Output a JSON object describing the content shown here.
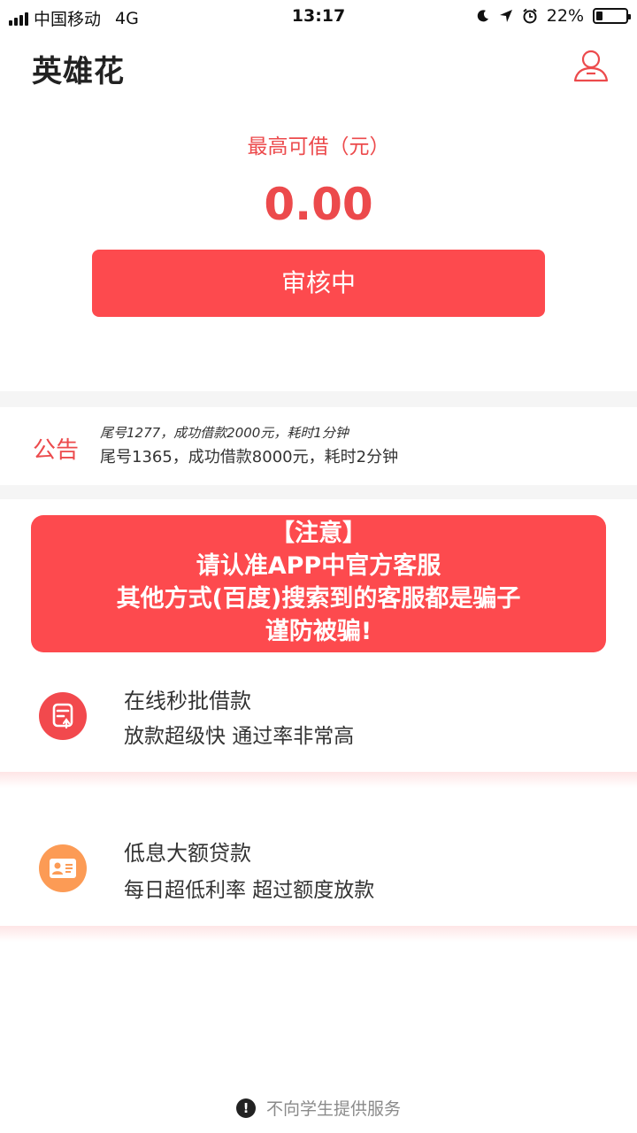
{
  "status_bar": {
    "carrier": "中国移动",
    "network": "4G",
    "time": "13:17",
    "battery": "22%",
    "battery_level": 0.22
  },
  "header": {
    "title": "英雄花",
    "user_icon": "user-icon"
  },
  "loan": {
    "limit_label": "最高可借（元）",
    "limit_amount": "0.00",
    "status_button": "审核中"
  },
  "notice": {
    "label": "公告",
    "items": [
      "尾号1277，成功借款2000元，耗时1分钟",
      "尾号1365，成功借款8000元，耗时2分钟"
    ]
  },
  "warning": {
    "lines": [
      "【注意】",
      "请认准APP中官方客服",
      "其他方式(百度)搜索到的客服都是骗子",
      "谨防被骗!"
    ]
  },
  "features": [
    {
      "icon": "document-icon",
      "icon_color": "#f2494d",
      "title": "在线秒批借款",
      "desc": "放款超级快 通过率非常高"
    },
    {
      "icon": "id-card-icon",
      "icon_color": "#fc9b55",
      "title": "低息大额贷款",
      "desc": "每日超低利率 超过额度放款"
    }
  ],
  "footer": {
    "icon": "alert-icon",
    "text": "不向学生提供服务"
  },
  "colors": {
    "accent": "#fd4a4e",
    "accent_text": "#ec4a4c",
    "orange": "#fc9b55"
  }
}
